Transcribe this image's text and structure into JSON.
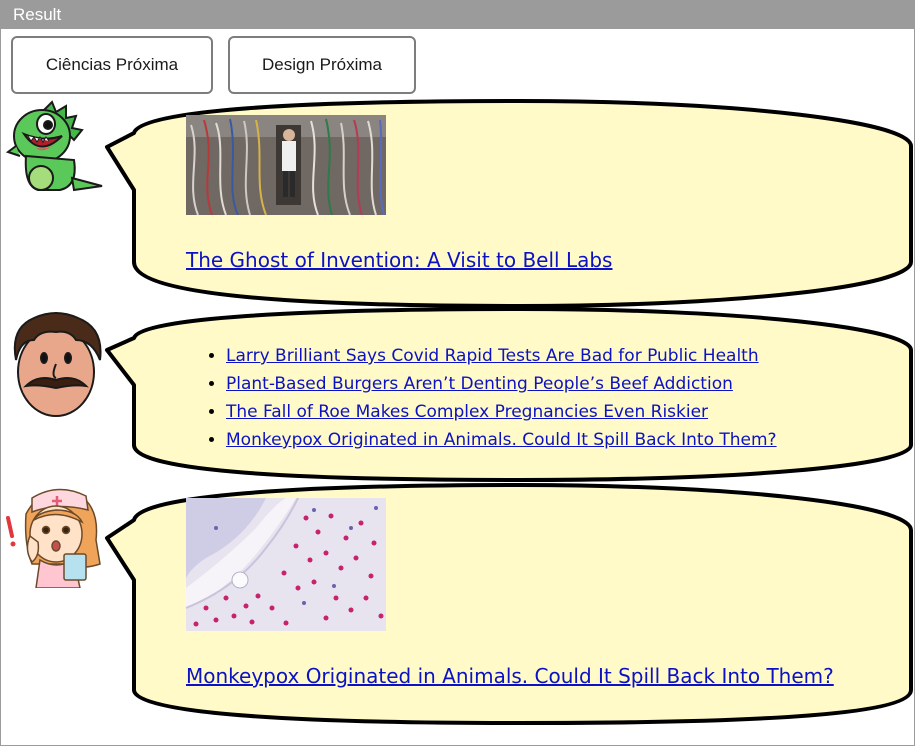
{
  "window": {
    "title": "Result"
  },
  "buttons": {
    "sciences_next": "Ciências Próxima",
    "design_next": "Design Próxima"
  },
  "bubble1": {
    "avatar": "dinosaur-icon",
    "image_alt": "server room cables",
    "link": "The Ghost of Invention: A Visit to Bell Labs"
  },
  "bubble2": {
    "avatar": "mustache-man-icon",
    "links": [
      "Larry Brilliant Says Covid Rapid Tests Are Bad for Public Health",
      "Plant-Based Burgers Aren’t Denting People’s Beef Addiction",
      "The Fall of Roe Makes Complex Pregnancies Even Riskier",
      "Monkeypox Originated in Animals. Could It Spill Back Into Them?"
    ]
  },
  "bubble3": {
    "avatar": "nurse-icon",
    "image_alt": "stained tissue micrograph",
    "link": "Monkeypox Originated in Animals. Could It Spill Back Into Them?"
  },
  "colors": {
    "bubble_fill": "#fffac8",
    "link": "#0b12c4",
    "titlebar": "#9b9b9b"
  }
}
